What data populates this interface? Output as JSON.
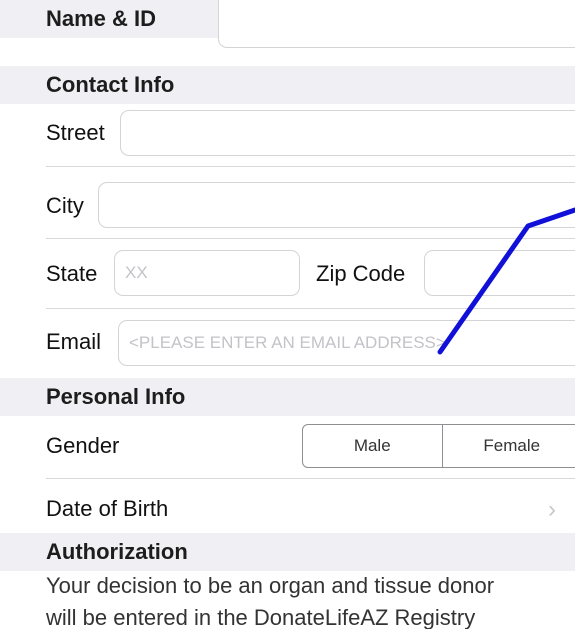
{
  "sections": {
    "name_id": "Name & ID",
    "contact": "Contact Info",
    "personal": "Personal Info",
    "authorization": "Authorization"
  },
  "contact": {
    "street_label": "Street",
    "street_value": "",
    "city_label": "City",
    "city_value": "",
    "state_label": "State",
    "state_placeholder": "XX",
    "zip_label": "Zip Code",
    "zip_value": "",
    "email_label": "Email",
    "email_placeholder": "<PLEASE ENTER AN EMAIL ADDRESS>"
  },
  "personal": {
    "gender_label": "Gender",
    "gender_options": [
      "Male",
      "Female"
    ],
    "dob_label": "Date of Birth",
    "dob_chevron": "›"
  },
  "authorization": {
    "line1": "Your decision to be an organ and tissue donor",
    "line2": "will be entered in the DonateLifeAZ Registry"
  },
  "colors": {
    "section_bg": "#efeff4",
    "annotation_line": "#1010d8",
    "field_border": "#d3d3d8"
  }
}
